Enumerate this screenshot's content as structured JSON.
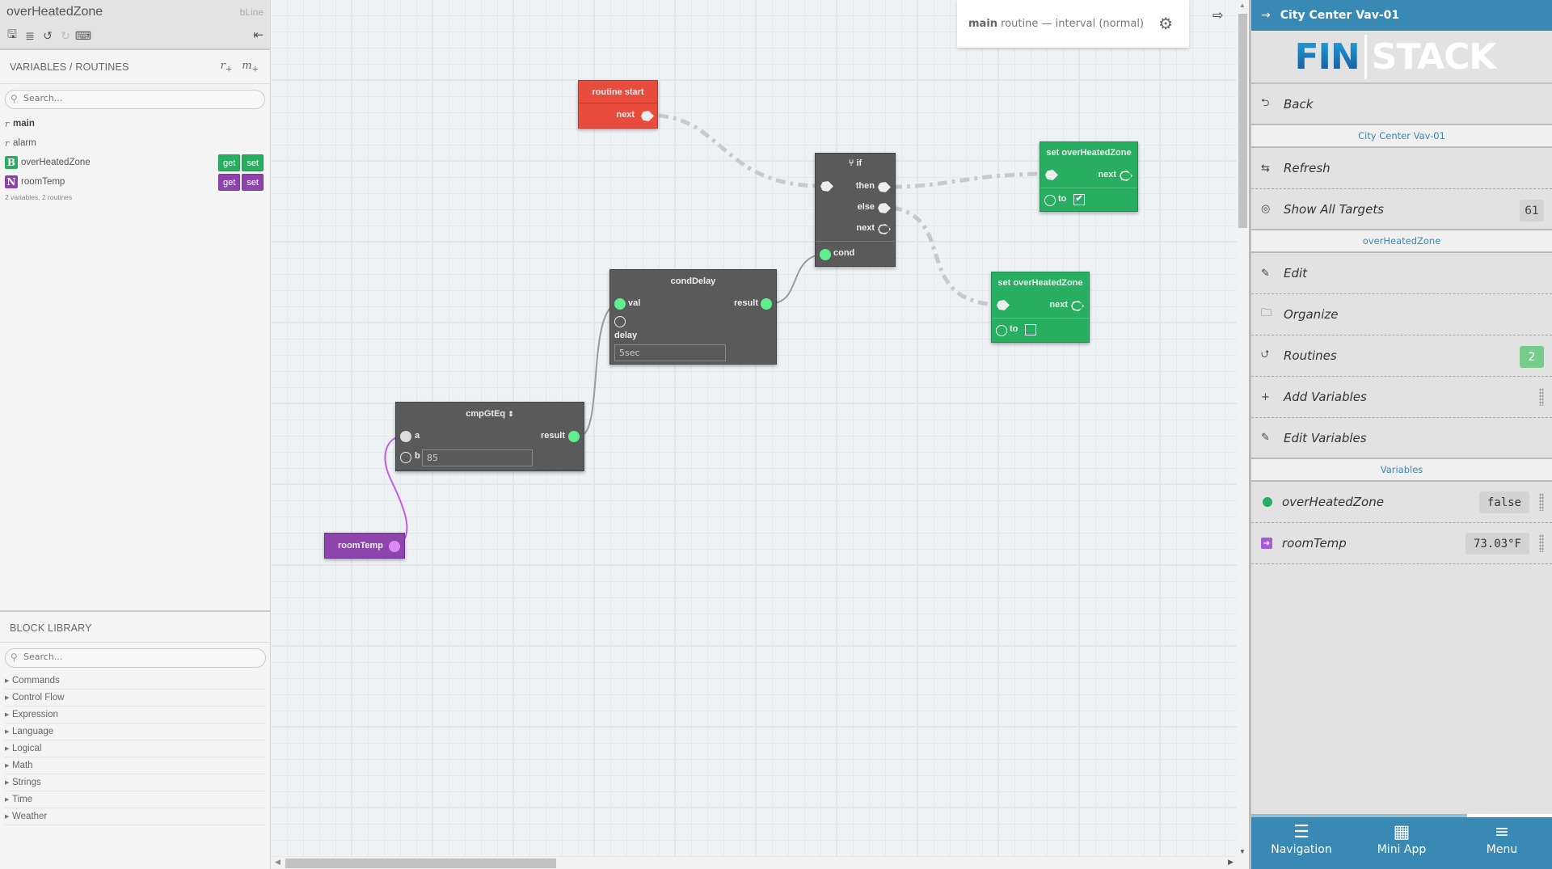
{
  "left_panel": {
    "doc_title": "overHeatedZone",
    "app_tag": "bLine",
    "tools": [
      "save-icon",
      "format-icon",
      "undo-icon",
      "redo-icon",
      "keyboard-icon"
    ],
    "collapse_icon": "collapse-left-icon",
    "variables_routines": {
      "heading": "VARIABLES / ROUTINES",
      "add_routine": "r",
      "add_macro": "m",
      "search_placeholder": "Search...",
      "routines": [
        {
          "name": "main",
          "active": true
        },
        {
          "name": "alarm",
          "active": false
        }
      ],
      "variables": [
        {
          "badge": "B",
          "name": "overHeatedZone",
          "get": "get",
          "set": "set",
          "color": "#27ae60"
        },
        {
          "badge": "N",
          "name": "roomTemp",
          "get": "get",
          "set": "set",
          "color": "#8e44ad"
        }
      ],
      "summary": "2 variables, 2 routines"
    },
    "block_library": {
      "heading": "BLOCK LIBRARY",
      "search_placeholder": "Search...",
      "categories": [
        "Commands",
        "Control Flow",
        "Expression",
        "Language",
        "Logical",
        "Math",
        "Strings",
        "Time",
        "Weather"
      ]
    }
  },
  "canvas": {
    "routine_card": {
      "name": "main",
      "text": "routine — interval (normal)"
    },
    "blocks": {
      "routine_start": {
        "title": "routine start",
        "next": "next"
      },
      "if": {
        "title": "if",
        "then": "then",
        "else": "else",
        "next": "next",
        "cond": "cond"
      },
      "set_true": {
        "title": "set overHeatedZone",
        "next": "next",
        "to": "to",
        "checked": true
      },
      "set_false": {
        "title": "set overHeatedZone",
        "next": "next",
        "to": "to",
        "checked": false
      },
      "cond_delay": {
        "title": "condDelay",
        "val": "val",
        "result": "result",
        "delay": "delay",
        "delay_value": "5sec"
      },
      "cmp": {
        "title": "cmpGtEq",
        "a": "a",
        "b": "b",
        "b_value": "85",
        "result": "result"
      },
      "room_temp": {
        "title": "roomTemp"
      }
    }
  },
  "right_panel": {
    "header": "City Center Vav-01",
    "logo_left": "FIN",
    "logo_right": "STACK",
    "back": "Back",
    "section1": "City Center Vav-01",
    "refresh": "Refresh",
    "show_all_targets": "Show All Targets",
    "targets_count": "61",
    "section2": "overHeatedZone",
    "edit": "Edit",
    "organize": "Organize",
    "routines": "Routines",
    "routines_count": "2",
    "add_variables": "Add Variables",
    "edit_variables": "Edit Variables",
    "section3": "Variables",
    "variables": [
      {
        "name": "overHeatedZone",
        "value": "false"
      },
      {
        "name": "roomTemp",
        "value": "73.03°F"
      }
    ],
    "bottom_nav": [
      {
        "label": "Navigation",
        "icon": "list-icon"
      },
      {
        "label": "Mini App",
        "icon": "grid-icon"
      },
      {
        "label": "Menu",
        "icon": "menu-icon"
      }
    ]
  }
}
